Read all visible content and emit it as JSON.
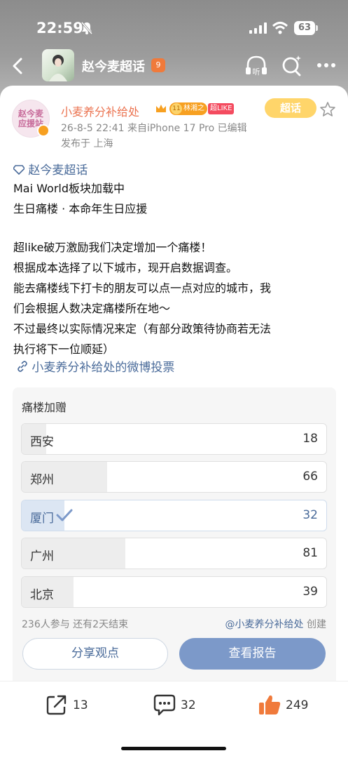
{
  "status_bar": {
    "time": "22:59",
    "battery": "63"
  },
  "nav": {
    "title": "赵今麦超话",
    "badge": "9"
  },
  "author": {
    "avatar_text_line1": "赵今麦",
    "avatar_text_line2": "应援站",
    "name": "小麦养分补给处",
    "fan_level": "11",
    "fan_badge": "林湘之",
    "like_badge": "超LIKE",
    "meta": "26-8-5 22:41  来自iPhone 17 Pro  已编辑",
    "location": "发布于 上海",
    "chaohua_tag": "超话"
  },
  "post": {
    "topic": "赵今麦超话",
    "lines_top": [
      "Mai World板块加载中",
      "生日痛楼 · 本命年生日应援"
    ],
    "lines_bottom": [
      "超like破万激励我们决定增加一个痛楼！",
      "根据成本选择了以下城市，现开启数据调查。",
      "能去痛楼线下打卡的朋友可以点一点对应的城市，我",
      "们会根据人数决定痛楼所在地～",
      "不过最终以实际情况来定（有部分政策待协商若无法",
      "执行将下一位顺延）"
    ],
    "vote_link": "小麦养分补给处的微博投票"
  },
  "poll": {
    "title": "痛楼加赠",
    "options": [
      {
        "label": "西安",
        "count": "18",
        "fraction": 0.08
      },
      {
        "label": "郑州",
        "count": "66",
        "fraction": 0.28
      },
      {
        "label": "厦门",
        "count": "32",
        "fraction": 0.14,
        "selected": true
      },
      {
        "label": "广州",
        "count": "81",
        "fraction": 0.34
      },
      {
        "label": "北京",
        "count": "39",
        "fraction": 0.17
      }
    ],
    "stats": "236人参与  还有2天结束",
    "creator": "@小麦养分补给处",
    "creator_suffix": " 创建",
    "share_label": "分享观点",
    "report_label": "查看报告"
  },
  "actions": {
    "share_count": "13",
    "comment_count": "32",
    "like_count": "249"
  },
  "colors": {
    "accent": "#7c99c9",
    "link": "#4a6b9a",
    "name": "#eb7350",
    "like": "#f07a3b"
  }
}
